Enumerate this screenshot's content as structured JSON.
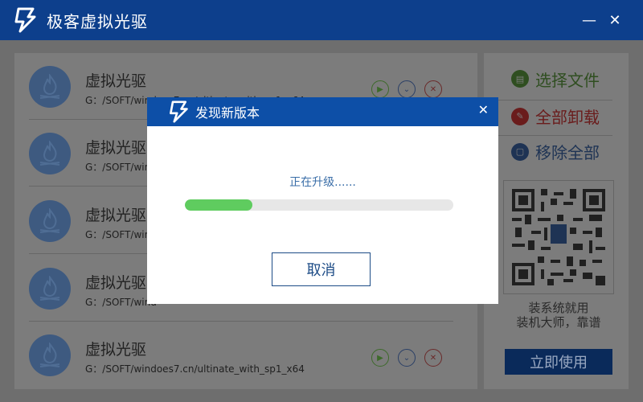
{
  "app": {
    "title": "极客虚拟光驱",
    "min_icon": "minimize-icon",
    "close_icon": "close-icon"
  },
  "list": {
    "items": [
      {
        "name": "虚拟光驱",
        "path": "G：/SOFT/windoes7.cn/ultinate_with_sp1_x64"
      },
      {
        "name": "虚拟光驱",
        "path": "G：/SOFT/wind"
      },
      {
        "name": "虚拟光驱",
        "path": "G：/SOFT/wind"
      },
      {
        "name": "虚拟光驱",
        "path": "G：/SOFT/wind"
      },
      {
        "name": "虚拟光驱",
        "path": "G：/SOFT/windoes7.cn/ultinate_with_sp1_x64"
      }
    ]
  },
  "side": {
    "select_label": "选择文件",
    "uninstall_label": "全部卸载",
    "removeall_label": "移除全部",
    "promo_line1": "装系统就用",
    "promo_line2": "装机大师，靠谱",
    "use_label": "立即使用"
  },
  "modal": {
    "title": "发现新版本",
    "status": "正在升级......",
    "progress": 0.25,
    "cancel_label": "取消"
  },
  "colors": {
    "titlebar": "#0d3f8c",
    "modal_header": "#0d4fa7",
    "progress_fill": "#5fcc5f",
    "accent_text": "#3a6ea8"
  }
}
